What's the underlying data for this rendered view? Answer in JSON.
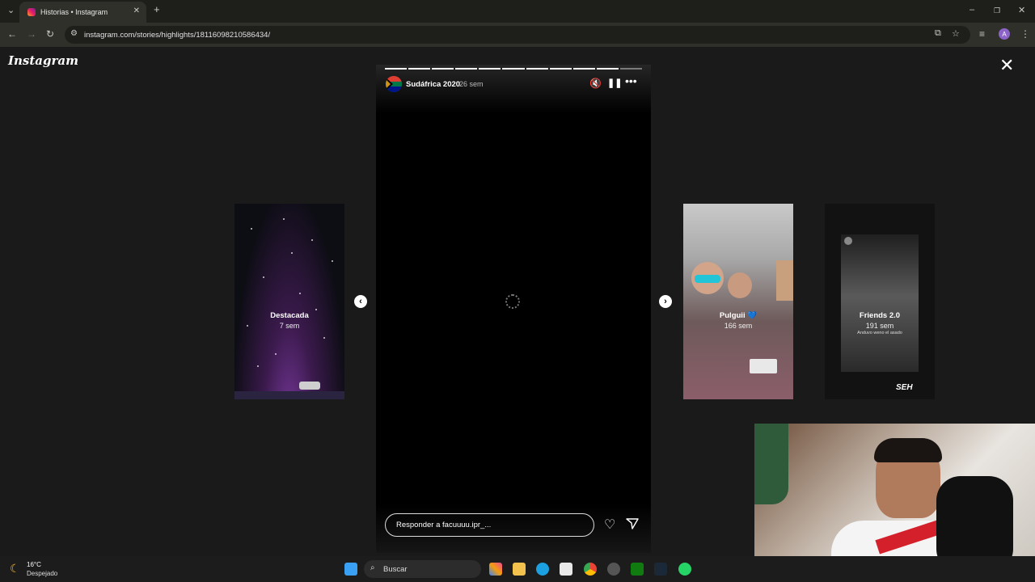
{
  "browser": {
    "tab_title": "Historias • Instagram",
    "url": "instagram.com/stories/highlights/18116098210586434/",
    "profile_initial": "A"
  },
  "page": {
    "logo_text": "Instagram"
  },
  "story": {
    "title": "Sudáfrica 2020",
    "age": "26 sem",
    "progress_total": 11,
    "progress_done": 10,
    "reply_placeholder": "Responder a facuuuu.ipr_..."
  },
  "previews": {
    "left": {
      "title": "Destacada",
      "age": "7 sem"
    },
    "right1": {
      "title": "Pulguii 💙",
      "age": "166 sem"
    },
    "right2": {
      "title": "Friends 2.0",
      "age": "191 sem",
      "caption": "Anduvo weno el asado",
      "sticker_text": "SEH"
    }
  },
  "taskbar": {
    "temperature": "16°C",
    "weather": "Despejado",
    "search_label": "Buscar"
  },
  "colors": {
    "accent_purple": "#8b63c9",
    "background": "#1a1a1a"
  }
}
